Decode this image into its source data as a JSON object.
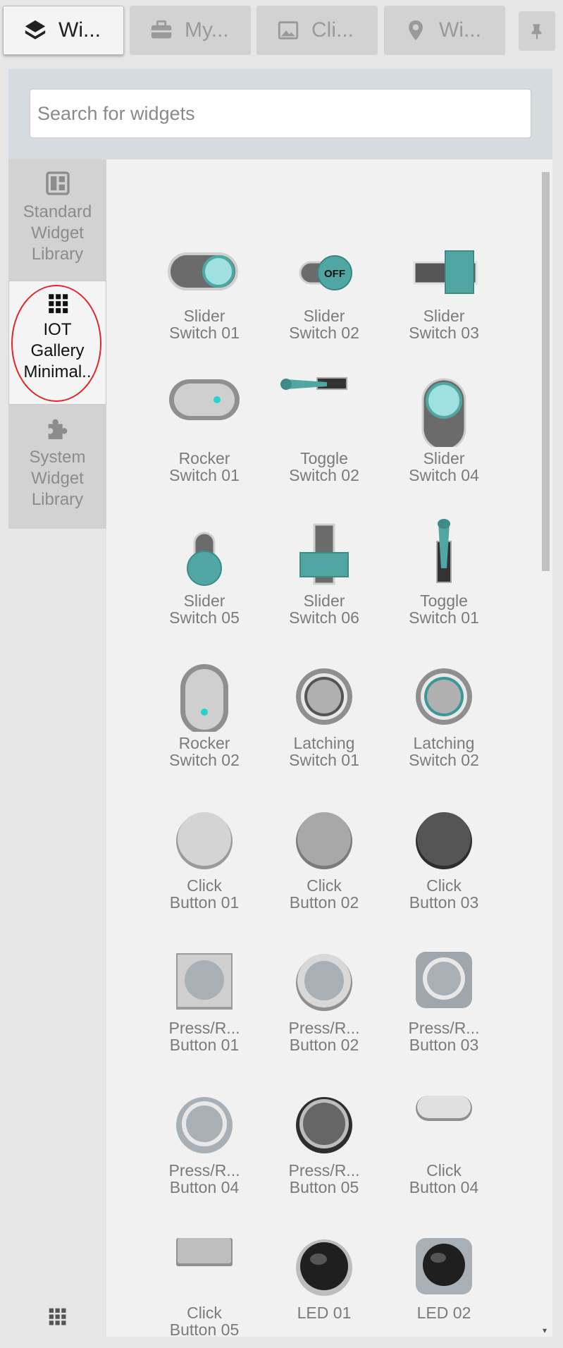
{
  "tabs": [
    {
      "label": "Wi...",
      "icon": "layers-icon",
      "active": true
    },
    {
      "label": "My...",
      "icon": "briefcase-icon",
      "active": false
    },
    {
      "label": "Cli...",
      "icon": "image-icon",
      "active": false
    },
    {
      "label": "Wi...",
      "icon": "map-pin-icon",
      "active": false
    }
  ],
  "pin_icon": "pin-icon",
  "search": {
    "placeholder": "Search for widgets",
    "value": ""
  },
  "nav": {
    "items": [
      {
        "label": "Standard\nWidget\nLibrary",
        "icon": "dashboard-icon",
        "active": false
      },
      {
        "label": "IOT\nGallery\nMinimal..",
        "icon": "apps-grid-icon",
        "active": true
      },
      {
        "label": "System\nWidget\nLibrary",
        "icon": "puzzle-icon",
        "active": false
      }
    ],
    "bottom_icon": "apps-grid-icon"
  },
  "colors": {
    "teal": "#4fa6a2",
    "highlight_circle": "#e0262b",
    "active_tab": "#f4f4f4",
    "inactive_tab": "#d2d2d2"
  },
  "widgets": [
    {
      "label": "Slider\nSwitch 01",
      "kind": "slider1"
    },
    {
      "label": "Slider\nSwitch 02",
      "kind": "slider2",
      "badge": "OFF"
    },
    {
      "label": "Slider\nSwitch 03",
      "kind": "slider3"
    },
    {
      "label": "Rocker\nSwitch 01",
      "kind": "rocker1"
    },
    {
      "label": "Toggle\nSwitch 02",
      "kind": "toggle2"
    },
    {
      "label": "Slider\nSwitch 04",
      "kind": "slider4"
    },
    {
      "label": "Slider\nSwitch 05",
      "kind": "slider5"
    },
    {
      "label": "Slider\nSwitch 06",
      "kind": "slider6"
    },
    {
      "label": "Toggle\nSwitch 01",
      "kind": "toggle1"
    },
    {
      "label": "Rocker\nSwitch 02",
      "kind": "rocker2"
    },
    {
      "label": "Latching\nSwitch 01",
      "kind": "latch1"
    },
    {
      "label": "Latching\nSwitch 02",
      "kind": "latch2"
    },
    {
      "label": "Click\nButton 01",
      "kind": "click1"
    },
    {
      "label": "Click\nButton 02",
      "kind": "click2"
    },
    {
      "label": "Click\nButton 03",
      "kind": "click3"
    },
    {
      "label": "Press/R...\nButton 01",
      "kind": "press1"
    },
    {
      "label": "Press/R...\nButton 02",
      "kind": "press2"
    },
    {
      "label": "Press/R...\nButton 03",
      "kind": "press3"
    },
    {
      "label": "Press/R...\nButton 04",
      "kind": "press4"
    },
    {
      "label": "Press/R...\nButton 05",
      "kind": "press5"
    },
    {
      "label": "Click\nButton 04",
      "kind": "click4"
    },
    {
      "label": "Click\nButton 05",
      "kind": "click5"
    },
    {
      "label": "LED 01",
      "kind": "led1"
    },
    {
      "label": "LED 02",
      "kind": "led2"
    }
  ]
}
